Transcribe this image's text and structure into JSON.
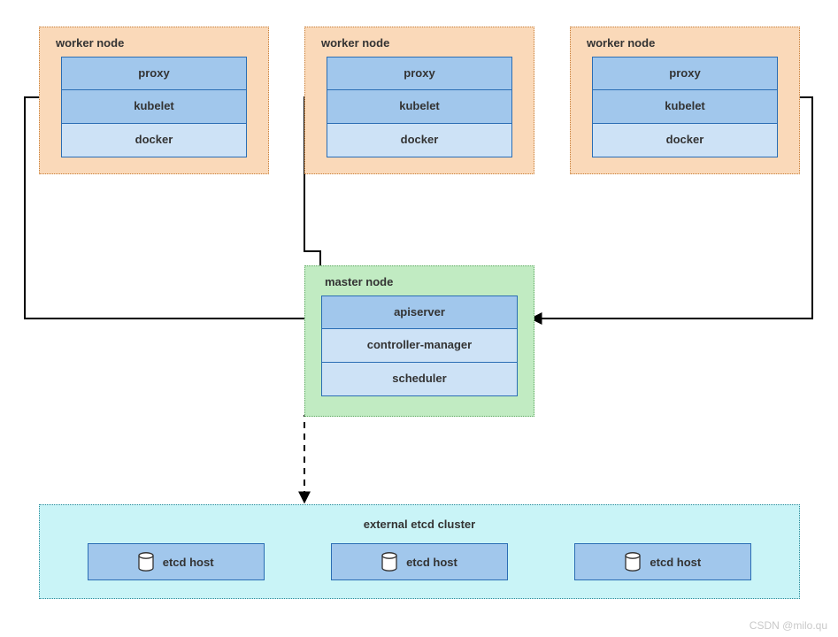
{
  "workers": [
    {
      "title": "worker node",
      "components": [
        "proxy",
        "kubelet",
        "docker"
      ]
    },
    {
      "title": "worker node",
      "components": [
        "proxy",
        "kubelet",
        "docker"
      ]
    },
    {
      "title": "worker node",
      "components": [
        "proxy",
        "kubelet",
        "docker"
      ]
    }
  ],
  "master": {
    "title": "master node",
    "components": [
      "apiserver",
      "controller-manager",
      "scheduler"
    ]
  },
  "etcd": {
    "title": "external etcd cluster",
    "hosts": [
      "etcd host",
      "etcd host",
      "etcd host"
    ]
  },
  "watermark": "CSDN @milo.qu",
  "colors": {
    "worker_bg": "#fad9b9",
    "master_bg": "#c1ebc2",
    "etcd_bg": "#c9f4f7",
    "box_border": "#2a6db4",
    "box_fill_mid": "#a1c7ec",
    "box_fill_light": "#cde2f6"
  }
}
